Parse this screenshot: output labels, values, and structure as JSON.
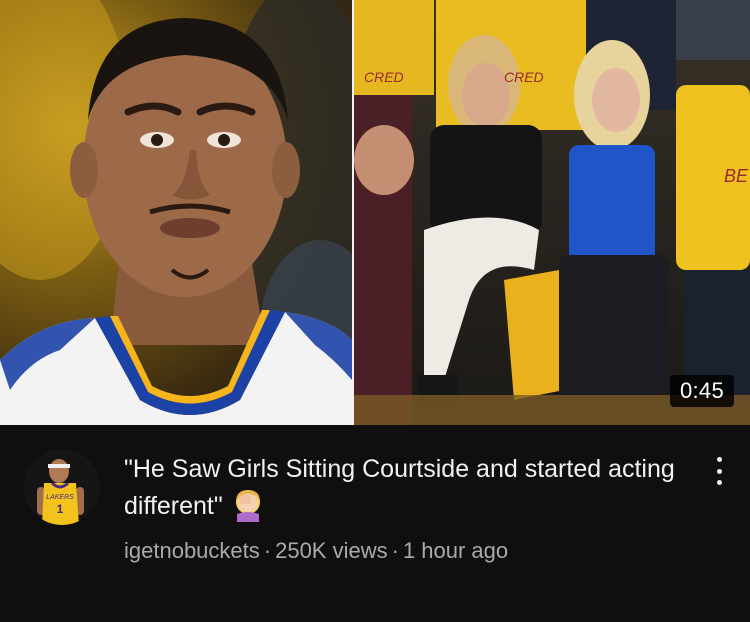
{
  "video": {
    "duration": "0:45",
    "title": "\"He Saw Girls Sitting Courtside and started acting different\"",
    "emoji": "🤦‍♀️",
    "channel": "igetnobuckets",
    "views": "250K views",
    "age": "1 hour ago",
    "separator": "·"
  },
  "avatar": {
    "jersey_text": "LAKERS",
    "jersey_number": "1"
  },
  "thumbnail": {
    "left_jersey_colors": {
      "body": "#f3f3f3",
      "trim": "#1d42a6",
      "accent": "#f5b51b"
    },
    "right_shirt_text": "CRED"
  },
  "colors": {
    "background": "#0f0f0f",
    "title_text": "#f1f1f1",
    "meta_text": "#aaaaaa"
  }
}
